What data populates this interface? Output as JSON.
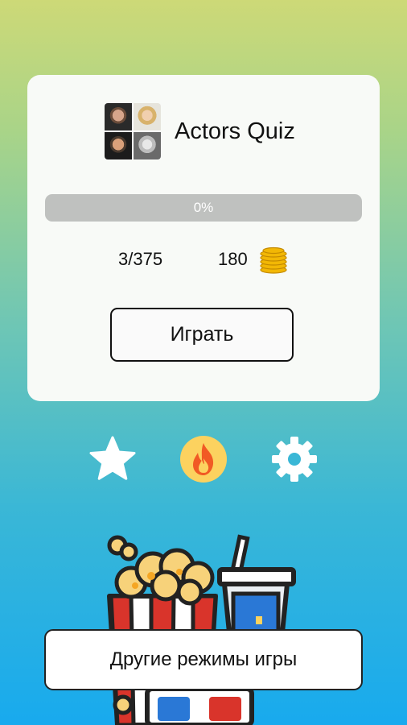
{
  "app": {
    "title": "Actors Quiz"
  },
  "progress": {
    "label": "0%",
    "value": 0
  },
  "stats": {
    "count": "3/375",
    "coins": "180"
  },
  "buttons": {
    "play_label": "Играть",
    "other_modes_label": "Другие режимы игры"
  },
  "icons": {
    "favorites": "star-icon",
    "hot": "fire-icon",
    "settings": "gear-icon"
  },
  "colors": {
    "accent": "#fcd25f",
    "fire": "#f15a24",
    "progress_track": "#bfc1bf"
  }
}
